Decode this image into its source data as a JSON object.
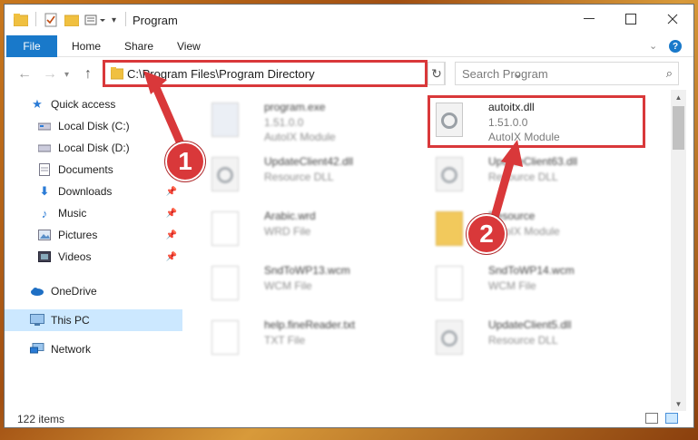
{
  "window": {
    "title": "Program"
  },
  "ribbon": {
    "file": "File",
    "tabs": [
      "Home",
      "Share",
      "View"
    ]
  },
  "navbar": {
    "address": "C:\\Program Files\\Program Directory",
    "search_placeholder": "Search Program"
  },
  "sidebar": {
    "items": [
      {
        "label": "Quick access",
        "icon": "star-icon"
      },
      {
        "label": "Local Disk (C:)",
        "icon": "drive-icon"
      },
      {
        "label": "Local Disk (D:)",
        "icon": "drive-icon"
      },
      {
        "label": "Documents",
        "icon": "documents-icon"
      },
      {
        "label": "Downloads",
        "icon": "download-icon"
      },
      {
        "label": "Music",
        "icon": "music-icon"
      },
      {
        "label": "Pictures",
        "icon": "pictures-icon"
      },
      {
        "label": "Videos",
        "icon": "videos-icon"
      },
      {
        "label": "OneDrive",
        "icon": "cloud-icon"
      },
      {
        "label": "This PC",
        "icon": "computer-icon"
      },
      {
        "label": "Network",
        "icon": "network-icon"
      }
    ]
  },
  "files": [
    {
      "name": "program.exe",
      "line2": "1.51.0.0",
      "line3": "AutoIX Module"
    },
    {
      "name": "autoitx.dll",
      "line2": "1.51.0.0",
      "line3": "AutoIX Module"
    },
    {
      "name": "UpdateClient42.dll",
      "line2": "Resource DLL"
    },
    {
      "name": "UpdateClient63.dll",
      "line2": "Resource DLL"
    },
    {
      "name": "Arabic.wrd",
      "line2": "WRD File"
    },
    {
      "name": "Resource",
      "line2": "AutoIX Module"
    },
    {
      "name": "SndToWP13.wcm",
      "line2": "WCM File"
    },
    {
      "name": "SndToWP14.wcm",
      "line2": "WCM File"
    },
    {
      "name": "help.fineReader.txt",
      "line2": "TXT File"
    },
    {
      "name": "UpdateClient5.dll",
      "line2": "Resource DLL"
    }
  ],
  "status": {
    "count": "122 items"
  },
  "callouts": {
    "one": "1",
    "two": "2"
  },
  "colors": {
    "accent": "#1979ca",
    "highlight": "#d9383a",
    "selected": "#cce8ff"
  }
}
